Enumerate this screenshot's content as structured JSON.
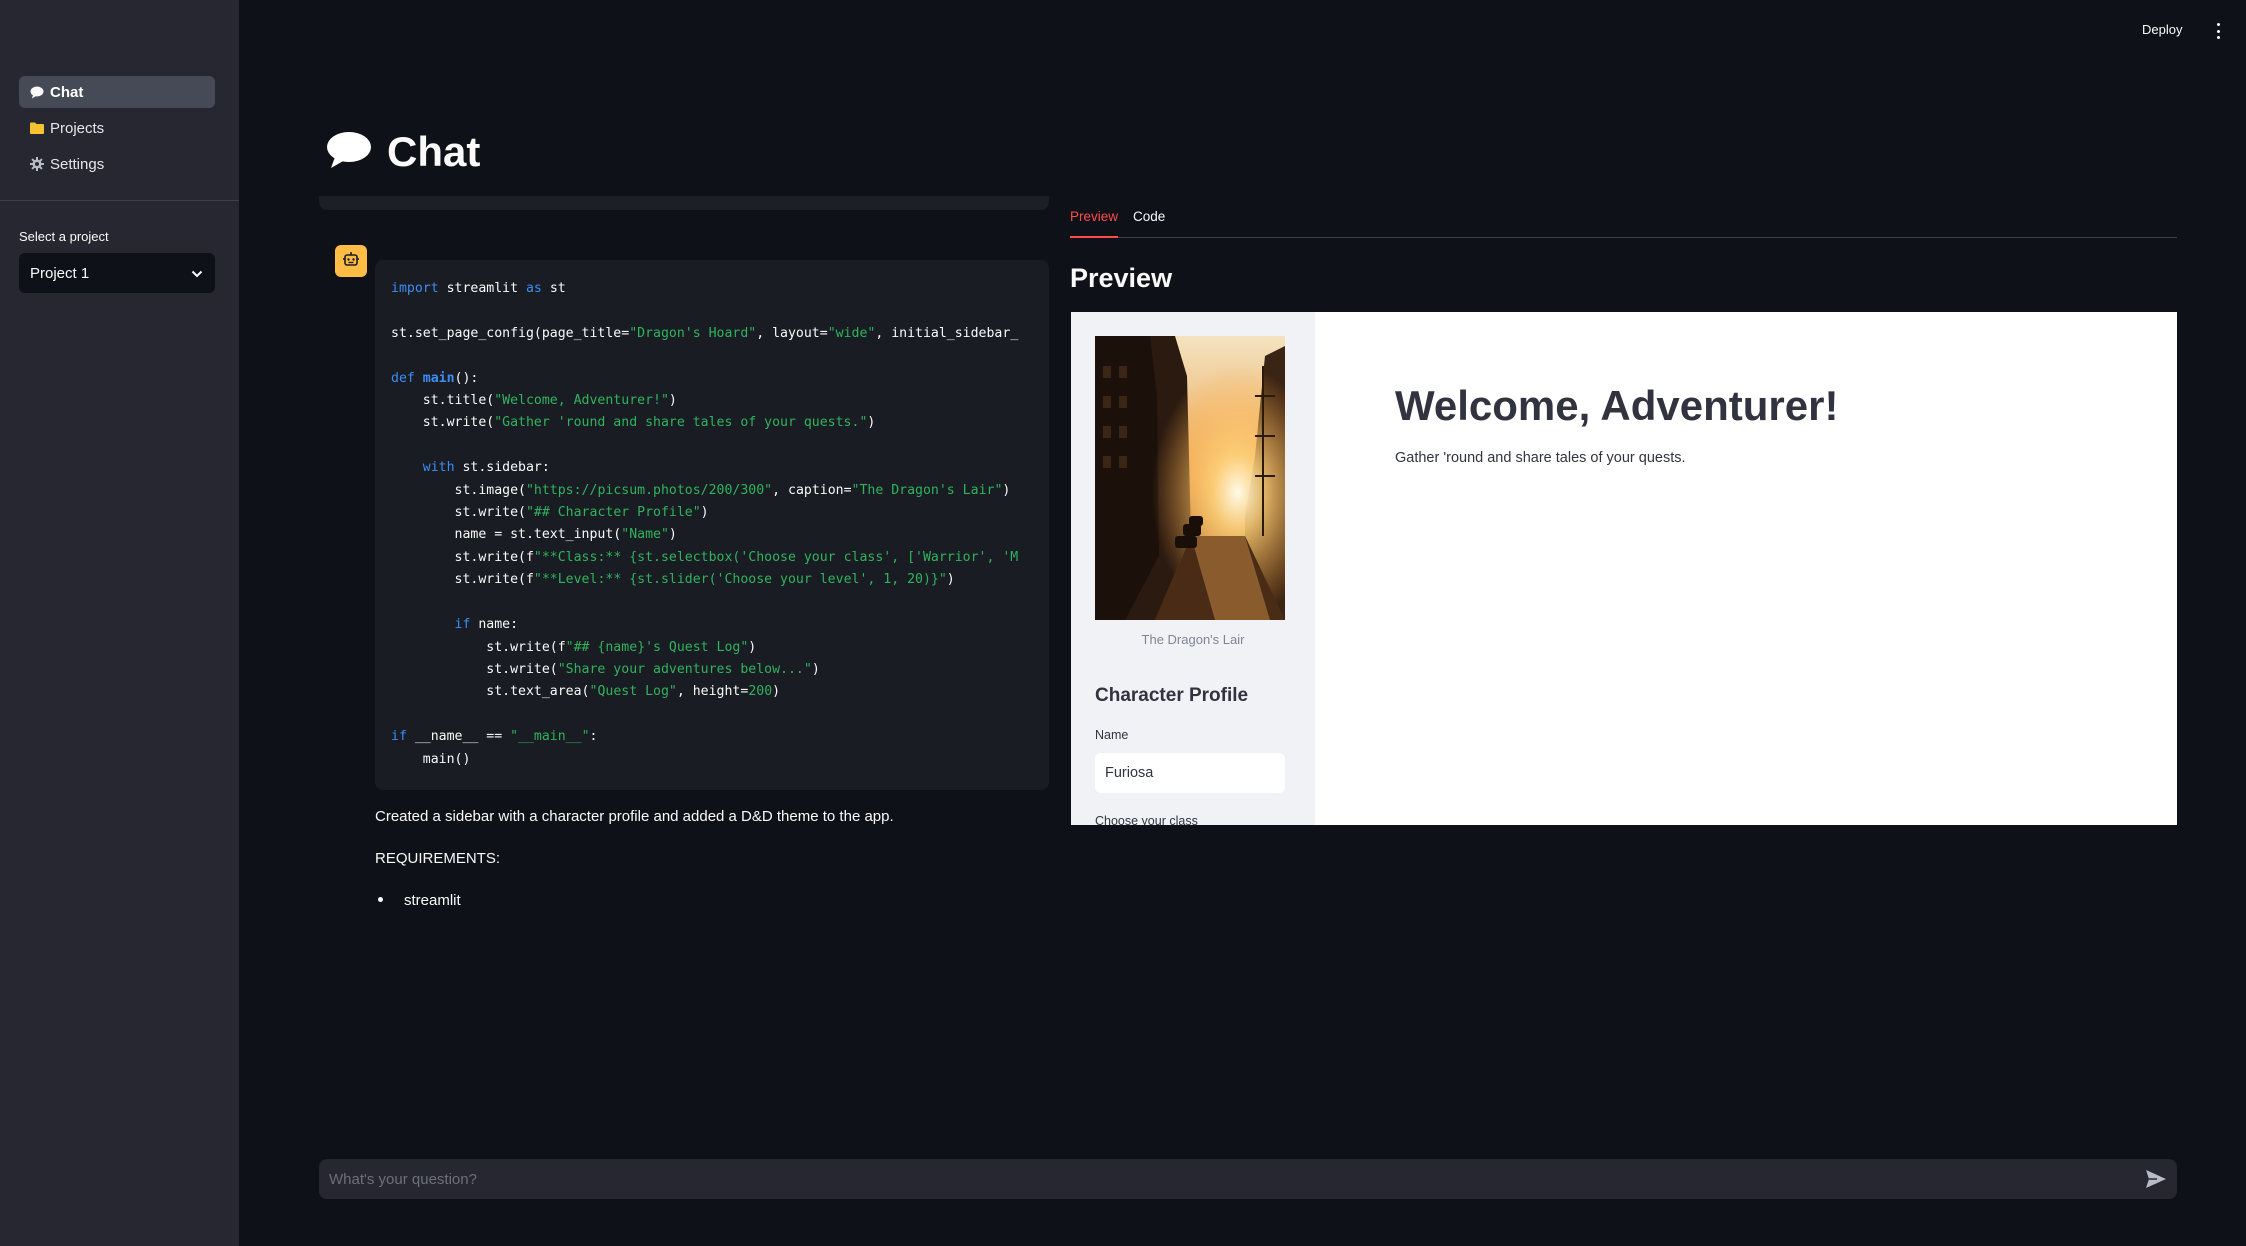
{
  "sidebar": {
    "nav": [
      {
        "label": "Chat",
        "icon": "speech-balloon-icon",
        "active": true
      },
      {
        "label": "Projects",
        "icon": "folder-icon",
        "active": false
      },
      {
        "label": "Settings",
        "icon": "gear-icon",
        "active": false
      }
    ],
    "select_label": "Select a project",
    "select_value": "Project 1"
  },
  "header": {
    "deploy_label": "Deploy"
  },
  "page": {
    "title": "Chat"
  },
  "chat": {
    "code_lines": [
      "import streamlit as st",
      "",
      "st.set_page_config(page_title=\"Dragon's Hoard\", layout=\"wide\", initial_sidebar_",
      "",
      "def main():",
      "    st.title(\"Welcome, Adventurer!\")",
      "    st.write(\"Gather 'round and share tales of your quests.\")",
      "",
      "    with st.sidebar:",
      "        st.image(\"https://picsum.photos/200/300\", caption=\"The Dragon's Lair\")",
      "        st.write(\"## Character Profile\")",
      "        name = st.text_input(\"Name\")",
      "        st.write(f\"**Class:** {st.selectbox('Choose your class', ['Warrior', 'M",
      "        st.write(f\"**Level:** {st.slider('Choose your level', 1, 20)}\")",
      "",
      "        if name:",
      "            st.write(f\"## {name}'s Quest Log\")",
      "            st.write(\"Share your adventures below...\")",
      "            st.text_area(\"Quest Log\", height=200)",
      "",
      "if __name__ == \"__main__\":",
      "    main()"
    ],
    "message": "Created a sidebar with a character profile and added a D&D theme to the app.",
    "requirements_label": "REQUIREMENTS:",
    "requirements": [
      "streamlit"
    ]
  },
  "preview": {
    "tabs": [
      {
        "label": "Preview",
        "active": true
      },
      {
        "label": "Code",
        "active": false
      }
    ],
    "heading": "Preview",
    "app": {
      "image_caption": "The Dragon's Lair",
      "profile_heading": "Character Profile",
      "name_label": "Name",
      "name_value": "Furiosa",
      "class_label": "Choose your class",
      "title": "Welcome, Adventurer!",
      "subtitle": "Gather 'round and share tales of your quests."
    }
  },
  "input": {
    "placeholder": "What's your question?"
  },
  "colors": {
    "accent": "#ff4b4b",
    "avatar": "#ffbd45",
    "sidebar": "#262730",
    "background": "#0e1117"
  }
}
